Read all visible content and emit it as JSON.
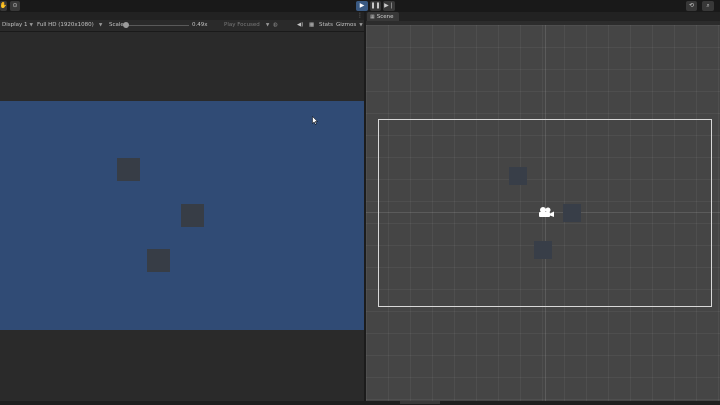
{
  "game_view": {
    "display": "Display 1",
    "resolution": "Full HD (1920x1080)",
    "scale_label": "Scale",
    "scale_value": "0.49x",
    "play_mode": "Play Focused",
    "stats": "Stats",
    "gizmos": "Gizmos",
    "background_color": "#304b75"
  },
  "scene_view": {
    "tab_label": "Scene",
    "background_color": "#454545"
  },
  "toolbar": {
    "play_icon": "play-icon",
    "pause_icon": "pause-icon",
    "step_icon": "step-icon"
  },
  "icons": {
    "top_left": [
      "hand-tool-icon",
      "settings-icon"
    ],
    "top_right": [
      "history-icon",
      "search-icon"
    ]
  }
}
